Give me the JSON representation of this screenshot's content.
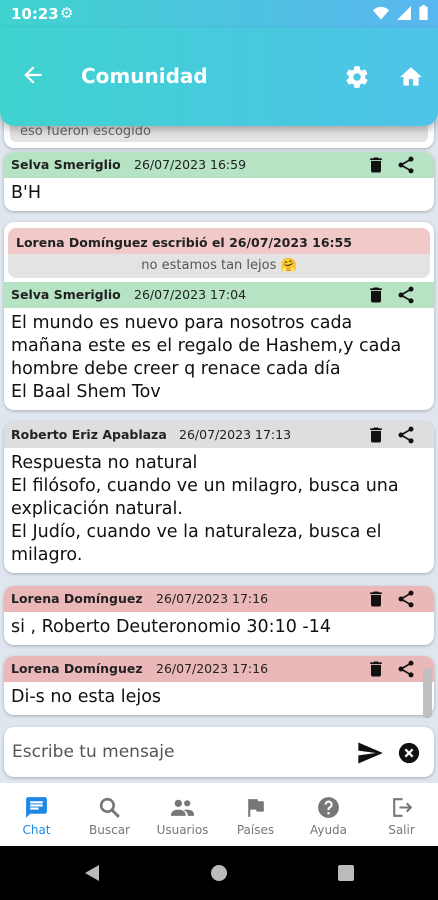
{
  "status_bar": {
    "time": "10:23"
  },
  "app_bar": {
    "title": "Comunidad"
  },
  "chat": {
    "previous_snippet": "eso fueron escogido",
    "messages": [
      {
        "author": "Selva Smeriglio",
        "datetime": "26/07/2023 16:59",
        "lines": [
          "B'H"
        ]
      },
      {
        "author": "Selva Smeriglio",
        "datetime": "26/07/2023 17:04",
        "quote": {
          "header": "Lorena Domínguez escribió el 26/07/2023 16:55",
          "text": "no estamos tan lejos 🤗"
        },
        "lines": [
          "El mundo es nuevo para nosotros cada",
          "mañana este es el regalo de Hashem,y cada",
          "hombre debe creer q renace cada día",
          "El Baal Shem Tov"
        ]
      },
      {
        "author": "Roberto Eriz Apablaza",
        "datetime": "26/07/2023 17:13",
        "lines": [
          "Respuesta no natural",
          "El filósofo, cuando ve un milagro, busca una",
          "explicación natural.",
          "El Judío, cuando ve la naturaleza, busca el",
          "milagro."
        ]
      },
      {
        "author": "Lorena Domínguez",
        "datetime": "26/07/2023 17:16",
        "lines": [
          "si , Roberto Deuteronomio 30:10 -14"
        ]
      },
      {
        "author": "Lorena Domínguez",
        "datetime": "26/07/2023 17:16",
        "lines": [
          "Di-s no esta lejos"
        ]
      }
    ]
  },
  "composer": {
    "placeholder": "Escribe tu mensaje"
  },
  "bottom_nav": {
    "items": [
      {
        "label": "Chat",
        "icon": "chat-icon",
        "active": true
      },
      {
        "label": "Buscar",
        "icon": "search-icon"
      },
      {
        "label": "Usuarios",
        "icon": "users-icon"
      },
      {
        "label": "Países",
        "icon": "flag-icon"
      },
      {
        "label": "Ayuda",
        "icon": "help-icon"
      },
      {
        "label": "Salir",
        "icon": "logout-icon"
      }
    ]
  },
  "colors": {
    "header_gradient_start": "#3fd3cf",
    "header_gradient_end": "#4ec3ea",
    "accent": "#1e88e5",
    "green_header": "#b5e3c4",
    "gray_header": "#dedede",
    "pink_header": "#eab8b8"
  }
}
